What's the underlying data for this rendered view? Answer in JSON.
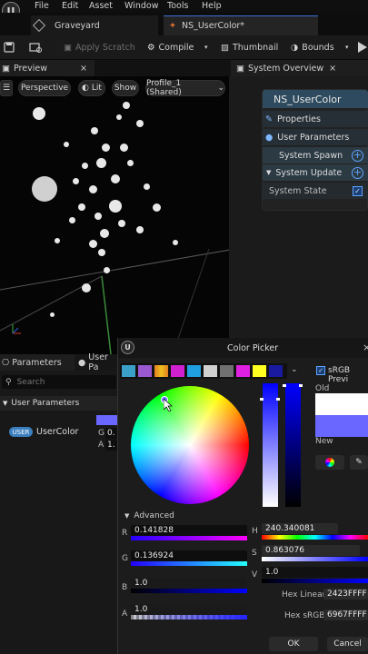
{
  "menu": {
    "items": [
      "File",
      "Edit",
      "Asset",
      "Window",
      "Tools",
      "Help"
    ]
  },
  "tabs": [
    {
      "label": "Graveyard"
    },
    {
      "label": "NS_UserColor*"
    }
  ],
  "toolbar": {
    "apply_scratch": "Apply Scratch",
    "compile": "Compile",
    "thumbnail": "Thumbnail",
    "bounds": "Bounds"
  },
  "preview": {
    "tab": "Preview",
    "perspective": "Perspective",
    "lit": "Lit",
    "show": "Show",
    "profile": "Profile_1 (Shared)"
  },
  "system_overview": {
    "tab": "System Overview",
    "node_title": "NS_UserColor",
    "properties": "Properties",
    "user_parameters": "User Parameters",
    "system_spawn": "System Spawn",
    "system_update": "System Update",
    "system_state": "System State"
  },
  "parameters_panel": {
    "tab_parameters": "Parameters",
    "tab_user": "User Pa",
    "search_placeholder": "Search",
    "section": "User Parameters",
    "badge": "USER",
    "param_name": "UserColor",
    "g_label": "G",
    "g_value": "0.",
    "a_label": "A",
    "a_value": "1."
  },
  "color_picker": {
    "title": "Color Picker",
    "srgb_label": "sRGB Previ",
    "old_label": "Old",
    "new_label": "New",
    "advanced": "Advanced",
    "r_label": "R",
    "r_value": "0.141828",
    "g_label": "G",
    "g_value": "0.136924",
    "b_label": "B",
    "b_value": "1.0",
    "a_label": "A",
    "a_value": "1.0",
    "h_label": "H",
    "h_value": "240.340081",
    "s_label": "S",
    "s_value": "0.863076",
    "v_label": "V",
    "v_value": "1.0",
    "hex_linear_label": "Hex Linear",
    "hex_linear_value": "2423FFFF",
    "hex_srgb_label": "Hex sRGB",
    "hex_srgb_value": "6967FFFF",
    "ok": "OK",
    "cancel": "Cancel",
    "old_color": "#ffffff",
    "new_color": "#6967ff",
    "swatches": [
      "#3aa0c8",
      "#9b59d0",
      "#e0a020",
      "#d020d0",
      "#20a0e0",
      "#c8c8c8",
      "#ffffff",
      "#707070",
      "#e020e0",
      "#ffff20",
      "#1a1aa0"
    ]
  },
  "colors": {
    "accent": "#5fa4ff",
    "user_badge": "#3c7fc0",
    "node_header": "#2e4a5e"
  }
}
